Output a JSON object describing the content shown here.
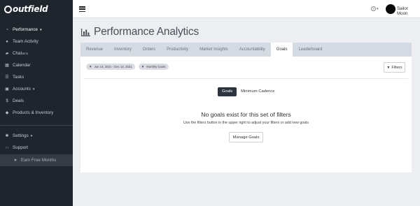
{
  "brand": {
    "logo_text": "outfield"
  },
  "sidebar": {
    "items": [
      {
        "label": "Performance",
        "icon": "gauge-icon",
        "caret": "▾"
      },
      {
        "label": "Team Activity",
        "icon": "map-pin-icon"
      },
      {
        "label": "Chat",
        "sup": "BETA",
        "icon": "chat-icon"
      },
      {
        "label": "Calendar",
        "icon": "calendar-icon"
      },
      {
        "label": "Tasks",
        "icon": "tasks-icon"
      },
      {
        "label": "Accounts",
        "icon": "building-icon",
        "caret": "▾"
      },
      {
        "label": "Deals",
        "icon": "dollar-icon"
      },
      {
        "label": "Products & Inventory",
        "icon": "tag-icon"
      }
    ],
    "bottom": [
      {
        "label": "Settings",
        "icon": "gear-icon",
        "caret": "▾"
      },
      {
        "label": "Support",
        "icon": "headset-icon"
      }
    ],
    "promo": {
      "label": "Earn Free Months",
      "icon": "star-icon"
    }
  },
  "topbar": {
    "help_glyph": "?",
    "help_caret": "▾",
    "username": "Sailor Moon"
  },
  "page": {
    "title": "Performance Analytics"
  },
  "tabs": [
    {
      "label": "Revenue",
      "active": false
    },
    {
      "label": "Inventory",
      "active": false
    },
    {
      "label": "Orders",
      "active": false
    },
    {
      "label": "Productivity",
      "active": false
    },
    {
      "label": "Market Insights",
      "active": false
    },
    {
      "label": "Accountability",
      "active": false
    },
    {
      "label": "Goals",
      "active": true
    },
    {
      "label": "Leaderboard",
      "active": false
    }
  ],
  "filters": {
    "date_chip": "Jun 14, 2021 - Dec 14, 2021",
    "type_chip": "Monthly Goals",
    "button_label": "Filters"
  },
  "toggle": {
    "goals": "Goals",
    "cadence": "Minimum Cadence"
  },
  "empty_state": {
    "title": "No goals exist for this set of filters",
    "subtitle": "Use the filters button in the upper right to adjust your filters or add new goals",
    "button": "Manage Goals"
  },
  "colors": {
    "sidebar_bg": "#1f252d",
    "tabs_bg": "#d5dbe2",
    "active_toggle": "#2c3440",
    "page_bg": "#eceef1"
  }
}
